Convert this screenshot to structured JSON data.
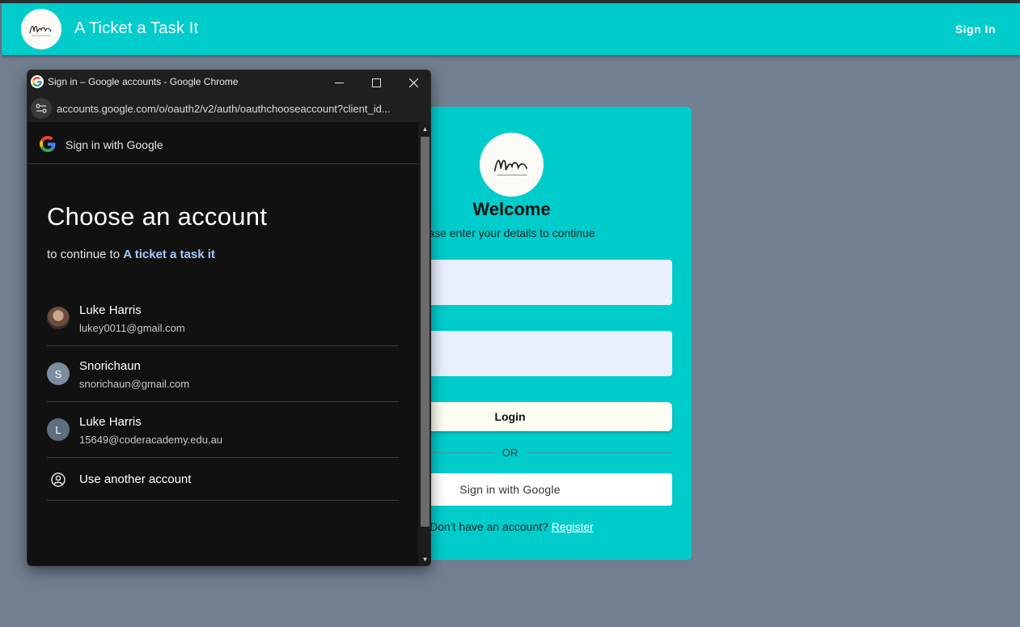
{
  "app": {
    "title": "A Ticket a Task It",
    "signin_label": "Sign In",
    "logo_text": "Mern"
  },
  "card": {
    "title": "Welcome",
    "subtitle": "ase enter your details to continue",
    "login_label": "Login",
    "or_label": "OR",
    "google_label": "Sign in with Google",
    "register_prompt": "Don't have an account?",
    "register_link": "Register"
  },
  "popup": {
    "window_title": "Sign in – Google accounts - Google Chrome",
    "url": "accounts.google.com/o/oauth2/v2/auth/oauthchooseaccount?client_id...",
    "header_text": "Sign in with Google",
    "heading": "Choose an account",
    "continue_prefix": "to continue to",
    "continue_app": "A ticket a task it",
    "accounts": [
      {
        "name": "Luke Harris",
        "email": "lukey0011@gmail.com",
        "avatar": "photo"
      },
      {
        "name": "Snorichaun",
        "email": "snorichaun@gmail.com",
        "avatar": "S",
        "avatar_color": "#7b8d9f"
      },
      {
        "name": "Luke Harris",
        "email": "15649@coderacademy.edu.au",
        "avatar": "L",
        "avatar_color": "#5d6e7e"
      }
    ],
    "use_another_label": "Use another account"
  },
  "colors": {
    "brand": "#00cccc",
    "background": "#717f90",
    "google_link": "#a8c7fa"
  }
}
